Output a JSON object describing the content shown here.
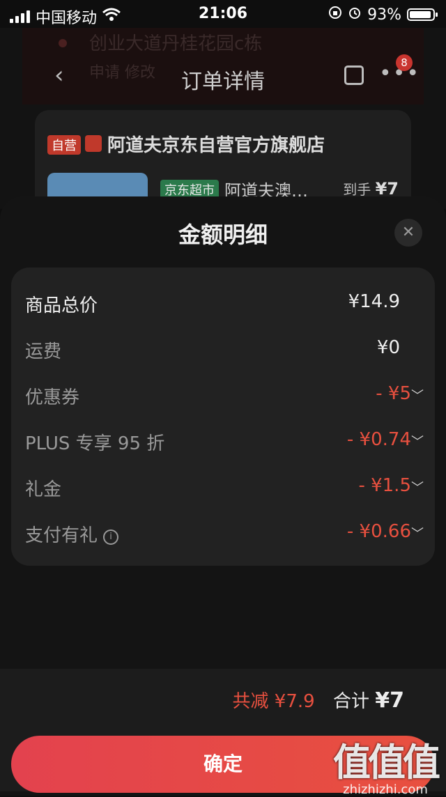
{
  "status_bar": {
    "carrier": "中国移动",
    "time": "21:06",
    "battery": "93%",
    "battery_level": 0.93
  },
  "background_page": {
    "address_line1": "创业大道丹桂花园c栋",
    "address_line2": "申请 修改",
    "nav_title": "订单详情",
    "message_badge": "8",
    "store_tag": "自营",
    "store_name": "阿道夫京东自营官方旗舰店",
    "product_tag": "京东超市",
    "product_name": "阿道夫澳…",
    "price_prefix": "到手",
    "price": "¥7"
  },
  "sheet": {
    "title": "金额明细",
    "rows": [
      {
        "label": "商品总价",
        "value": "¥14.9"
      },
      {
        "label": "运费",
        "value": "¥0"
      },
      {
        "label": "优惠券",
        "value": "- ¥5"
      },
      {
        "label": "PLUS 专享 95 折",
        "value": "- ¥0.74"
      },
      {
        "label": "礼金",
        "value": "- ¥1.5"
      },
      {
        "label": "支付有礼",
        "value": "- ¥0.66"
      }
    ],
    "discount_total": "共减 ¥7.9",
    "total_label": "合计",
    "total_value": "¥7",
    "confirm": "确定"
  },
  "watermark": {
    "big": "值值值",
    "small": "zhizhizhi.com"
  },
  "colors": {
    "accent_red": "#e8503f",
    "button_start": "#e3424e",
    "button_end": "#e8503f",
    "sheet_bg": "#141414",
    "card_bg": "#222222"
  }
}
